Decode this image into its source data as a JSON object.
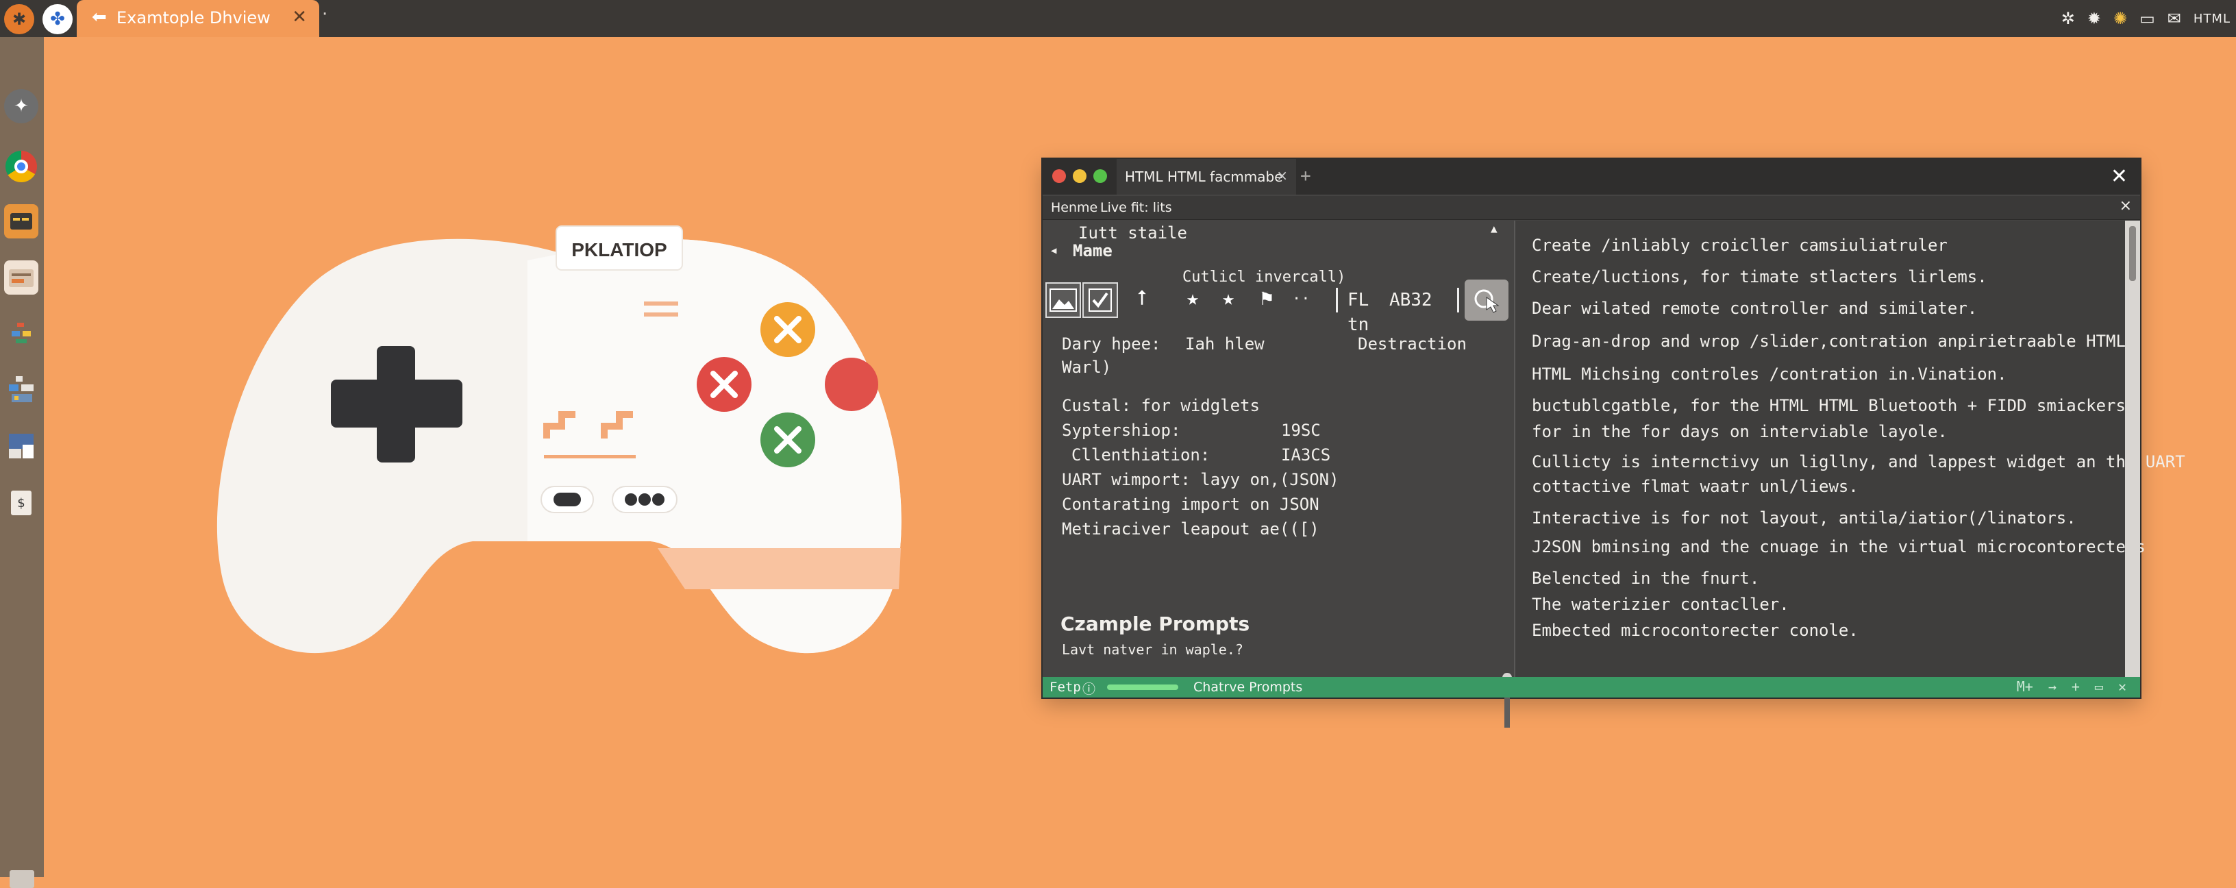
{
  "topbar": {
    "tab_title": "Examtople  Dhview",
    "tab_back": "⬅",
    "tab_close": "✕",
    "new_tab": "·",
    "tray_text": "HTML"
  },
  "gamepad": {
    "brand": "PKLATIOP"
  },
  "window": {
    "tab_title": "HTML HTML facmmabe",
    "tab_close": "×",
    "new_tab": "+",
    "close": "✕",
    "menu": [
      "Henme",
      "Live fit: lits"
    ],
    "menu_close": "×",
    "left": {
      "heading_small": "Iutt staile",
      "section_label": "Mame",
      "toolbar_caption": "Cutlicl invercall)",
      "toolbar_dots": "..",
      "toolbar_field_prefix": "FL",
      "toolbar_field_value": "AB32 tn",
      "row1_label": "Dary hpee:",
      "row1_value": "Iah hlew",
      "row1_right": "Destraction",
      "row1_cont": "Warl)",
      "row2_label": "Custal: for widglets",
      "row3_label": "Syptershiop:",
      "row3_value": "19SC",
      "row4_label": "Cllenthiation:",
      "row4_value": "IA3CS",
      "row5_label": "UART wimport: layy on,(JSON)",
      "row6_label": "Contarating import on JSON",
      "row7_label": "Metiraciver leapout ae(([)",
      "prompts_title": "Czample Prompts",
      "prompts_sub": "Lavt natver in waple.?"
    },
    "right_lines": [
      "Create /inliably croicller camsiuliatruler",
      "Create/luctions, for timate stlacters lirlems.",
      "Dear wilated remote controller and similater.",
      "Drag-an-drop and wrop /slider,contration anpirietraable HTML",
      "HTML Michsing controles /contration in.Vination.",
      "buctublcgatble, for the HTML HTML Bluetooth + FIDD smiackers.",
      "for in the for days on interviable layole.",
      "Cullicty is internctivy un ligllny, and lappest widget an the UART",
      "cottactive flmat waatr unl/liews.",
      "Interactive is for not layout, antila/iatior(/linators.",
      "J2SON bminsing and the cnuage in the virtual microcontorecters",
      "Belencted in the fnurt.",
      "The waterizier contacller.",
      "Embected microcontorecter conole."
    ],
    "status": {
      "left": "Fetp",
      "middle": "Chatrve Prompts",
      "right_label": "M+"
    }
  }
}
